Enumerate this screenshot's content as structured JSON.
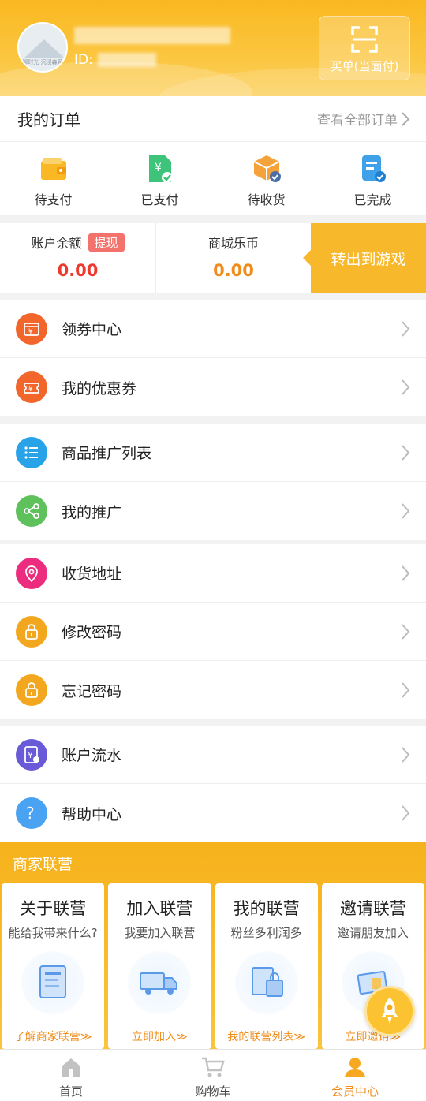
{
  "header": {
    "id_label": "ID:",
    "pay_button_label": "买单(当面付)",
    "avatar_caption": "聊时光  沉浸森系"
  },
  "orders": {
    "title": "我的订单",
    "view_all": "查看全部订单",
    "items": [
      {
        "label": "待支付",
        "icon": "wallet-icon"
      },
      {
        "label": "已支付",
        "icon": "paid-bill-icon"
      },
      {
        "label": "待收货",
        "icon": "package-icon"
      },
      {
        "label": "已完成",
        "icon": "completed-doc-icon"
      }
    ]
  },
  "balance": {
    "account_label": "账户余额",
    "withdraw_label": "提现",
    "account_value": "0.00",
    "coin_label": "商城乐币",
    "coin_value": "0.00",
    "transfer_label": "转出到游戏"
  },
  "menu_groups": [
    {
      "items": [
        {
          "label": "领券中心",
          "icon": "coupon-center-icon",
          "color": "#f2662c"
        },
        {
          "label": "我的优惠券",
          "icon": "my-coupon-icon",
          "color": "#f2662c"
        }
      ]
    },
    {
      "items": [
        {
          "label": "商品推广列表",
          "icon": "list-icon",
          "color": "#29a3e8"
        },
        {
          "label": "我的推广",
          "icon": "share-icon",
          "color": "#5fc15c"
        }
      ]
    },
    {
      "items": [
        {
          "label": "收货地址",
          "icon": "location-pin-icon",
          "color": "#ec2c7e"
        },
        {
          "label": "修改密码",
          "icon": "lock-icon",
          "color": "#f3a71e"
        },
        {
          "label": "忘记密码",
          "icon": "lock-icon",
          "color": "#f3a71e"
        }
      ]
    },
    {
      "items": [
        {
          "label": "账户流水",
          "icon": "account-flow-icon",
          "color": "#6a5ad8"
        },
        {
          "label": "帮助中心",
          "icon": "help-icon",
          "color": "#4aa3f2"
        }
      ]
    }
  ],
  "merchant": {
    "title": "商家联营",
    "cards": [
      {
        "title": "关于联营",
        "subtitle": "能给我带来什么?",
        "link": "了解商家联营≫"
      },
      {
        "title": "加入联营",
        "subtitle": "我要加入联营",
        "link": "立即加入≫"
      },
      {
        "title": "我的联营",
        "subtitle": "粉丝多利润多",
        "link": "我的联营列表≫"
      },
      {
        "title": "邀请联营",
        "subtitle": "邀请朋友加入",
        "link": "立即邀请≫"
      }
    ]
  },
  "bottom_nav": [
    {
      "label": "首页",
      "icon": "home-icon"
    },
    {
      "label": "购物车",
      "icon": "cart-icon"
    },
    {
      "label": "会员中心",
      "icon": "member-icon",
      "active": true
    }
  ],
  "colors": {
    "brand": "#f8b82b",
    "price_red": "#ee3a2e",
    "price_orange": "#f08d1a"
  }
}
